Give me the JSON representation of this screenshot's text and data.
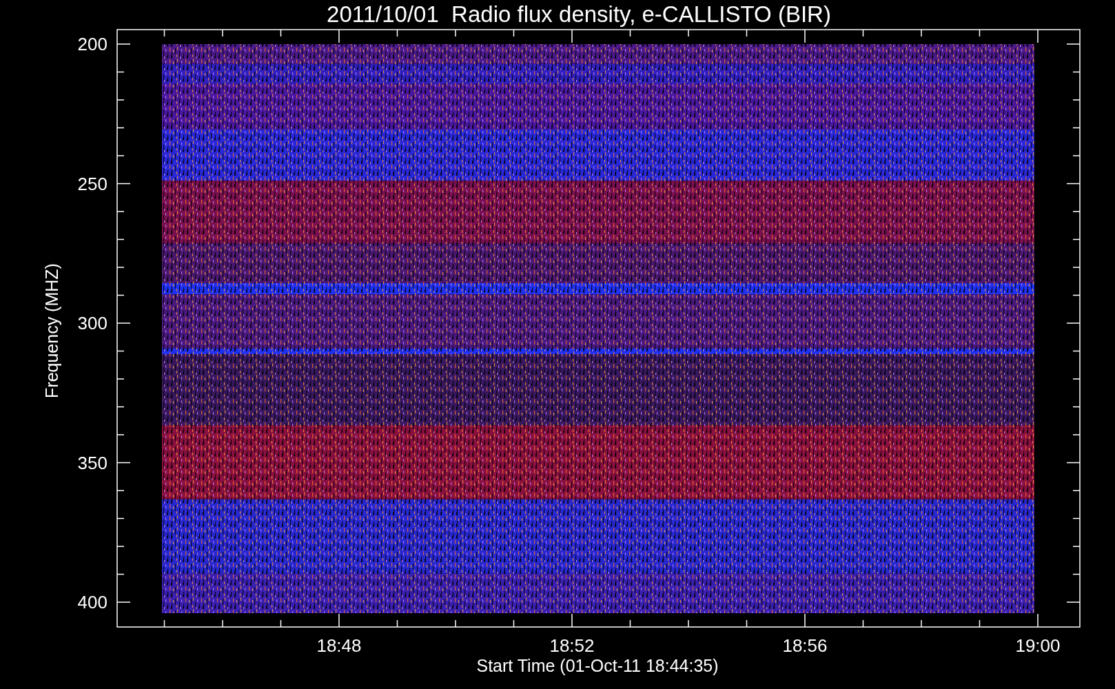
{
  "title": "2011/10/01  Radio flux density, e-CALLISTO (BIR)",
  "y_axis": {
    "label": "Frequency (MHZ)",
    "ticks": [
      "200",
      "250",
      "300",
      "350",
      "400"
    ]
  },
  "x_axis": {
    "label": "Start Time (01-Oct-11 18:44:35)",
    "ticks": [
      "18:48",
      "18:52",
      "18:56",
      "19:00"
    ]
  }
}
